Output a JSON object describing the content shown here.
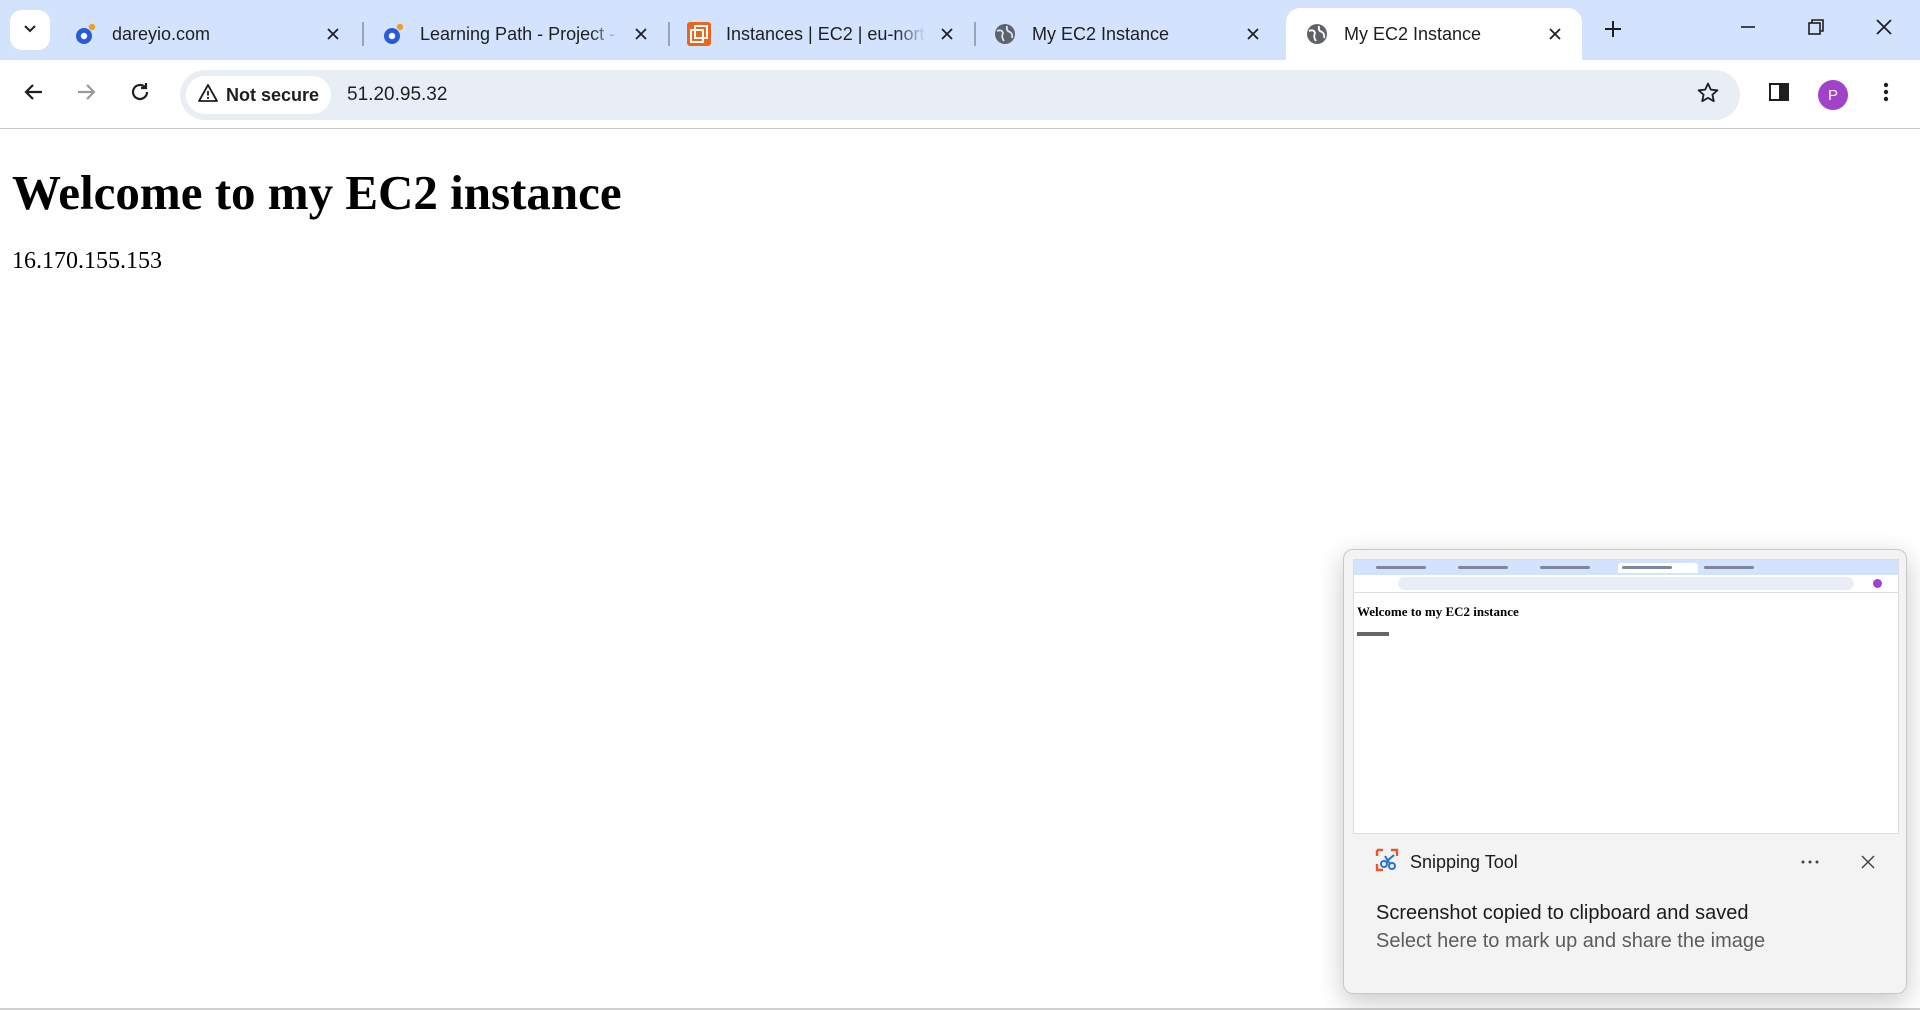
{
  "browser": {
    "tabs": [
      {
        "title": "dareyio.com",
        "favicon": "dareyio-logo-icon"
      },
      {
        "title": "Learning Path - Project -",
        "favicon": "dareyio-logo-icon"
      },
      {
        "title": "Instances | EC2 | eu-north",
        "favicon": "aws-ec2-icon"
      },
      {
        "title": "My EC2 Instance",
        "favicon": "globe-icon"
      },
      {
        "title": "My EC2 Instance",
        "favicon": "globe-icon",
        "active": true
      }
    ],
    "address_bar": {
      "security_label": "Not secure",
      "url": "51.20.95.32"
    },
    "profile_initial": "P",
    "colors": {
      "tabstrip": "#d3e3fd",
      "omnibox": "#e9eef6",
      "avatar": "#a142c9"
    }
  },
  "page": {
    "heading": "Welcome to my EC2 instance",
    "ip_text": "16.170.155.153"
  },
  "snipping_toast": {
    "app_name": "Snipping Tool",
    "message": "Screenshot copied to clipboard and saved",
    "sub_message": "Select here to mark up and share the image",
    "thumbnail_heading": "Welcome to my EC2 instance"
  }
}
